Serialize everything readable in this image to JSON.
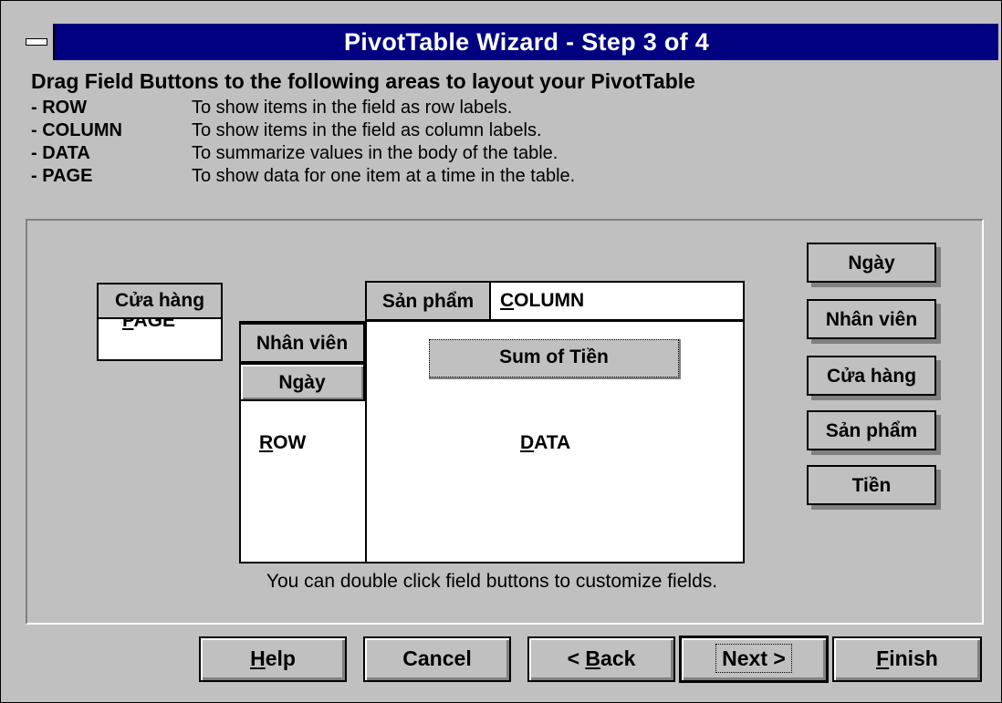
{
  "window": {
    "title": "PivotTable Wizard - Step 3 of 4"
  },
  "instructions": {
    "heading": "Drag Field Buttons to the following areas to layout your PivotTable",
    "items": [
      {
        "key": "- ROW",
        "desc": "To show items in the field as row labels."
      },
      {
        "key": "- COLUMN",
        "desc": "To show items in the field as column labels."
      },
      {
        "key": "- DATA",
        "desc": "To summarize values in the body of the table."
      },
      {
        "key": "- PAGE",
        "desc": "To show data for one item at a time in the table."
      }
    ]
  },
  "layout": {
    "page_area": {
      "label_prefix": "P",
      "label_rest": "AGE",
      "field": "Cửa hàng"
    },
    "row_area": {
      "label_prefix": "R",
      "label_rest": "OW",
      "fields": [
        "Nhân viên",
        "Ngày"
      ]
    },
    "column_area": {
      "label_prefix": "C",
      "label_rest": "OLUMN",
      "fields": [
        "Sản phẩm"
      ]
    },
    "data_area": {
      "label_prefix": "D",
      "label_rest": "ATA",
      "fields": [
        "Sum of Tiền"
      ]
    }
  },
  "available_fields": [
    "Ngày",
    "Nhân viên",
    "Cửa hàng",
    "Sản phẩm",
    "Tiền"
  ],
  "hint": "You can double click field buttons to customize fields.",
  "buttons": {
    "help": {
      "prefix": "H",
      "rest": "elp"
    },
    "cancel": "Cancel",
    "back": {
      "before": "< ",
      "prefix": "B",
      "rest": "ack"
    },
    "next": "Next >",
    "finish": {
      "prefix": "F",
      "rest": "inish"
    }
  }
}
